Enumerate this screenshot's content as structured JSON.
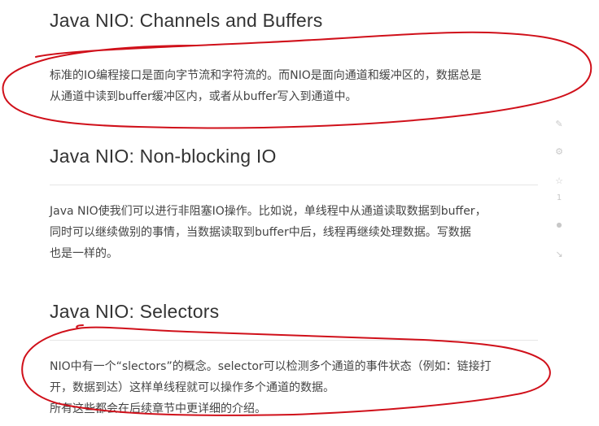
{
  "sections": [
    {
      "title": "Java NIO: Channels and Buffers",
      "lines": [
        "标准的IO编程接口是面向字节流和字符流的。而NIO是面向通道和缓冲区的，数据总是",
        "从通道中读到buffer缓冲区内，或者从buffer写入到通道中。"
      ]
    },
    {
      "title": "Java NIO: Non-blocking IO",
      "lines": [
        "Java NIO使我们可以进行非阻塞IO操作。比如说，单线程中从通道读取数据到buffer，",
        "同时可以继续做别的事情，当数据读取到buffer中后，线程再继续处理数据。写数据",
        "也是一样的。"
      ]
    },
    {
      "title": "Java NIO: Selectors",
      "lines": [
        "NIO中有一个“slectors”的概念。selector可以检测多个通道的事件状态（例如：链接打",
        "开，数据到达）这样单线程就可以操作多个通道的数据。",
        "所有这些都会在后续章节中更详细的介绍。"
      ]
    }
  ],
  "side_toolbar": {
    "items": [
      {
        "icon": "pencil-icon",
        "glyph": "✎"
      },
      {
        "icon": "settings-icon",
        "glyph": "⚙"
      },
      {
        "icon": "like-icon",
        "glyph": "☆"
      },
      {
        "icon": "count-label",
        "glyph": "1"
      },
      {
        "icon": "comment-icon",
        "glyph": "●"
      },
      {
        "icon": "share-icon",
        "glyph": "↘"
      }
    ]
  },
  "colors": {
    "annotation_stroke": "#d0101a",
    "heading": "#333333",
    "body_text": "#444444",
    "rule": "#e6e6e6"
  }
}
